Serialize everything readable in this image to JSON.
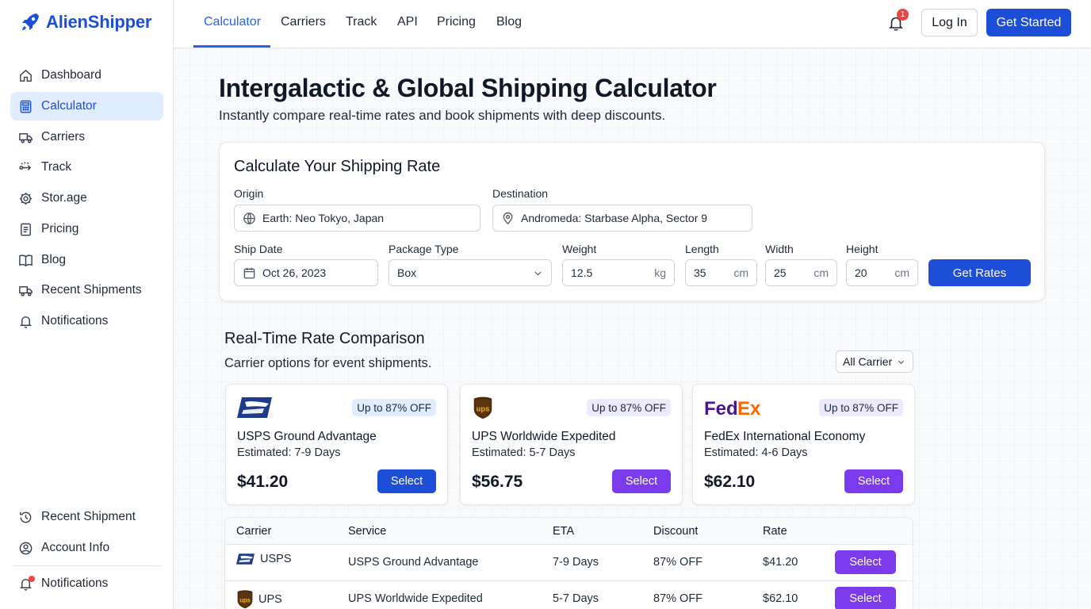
{
  "brand": {
    "name": "AlienShipper"
  },
  "sidebar": {
    "items": [
      {
        "label": "Dashboard",
        "icon": "home-icon"
      },
      {
        "label": "Calculator",
        "icon": "calculator-icon"
      },
      {
        "label": "Carriers",
        "icon": "truck-icon"
      },
      {
        "label": "Track",
        "icon": "route-icon"
      },
      {
        "label": "Stor.age",
        "icon": "gear-icon"
      },
      {
        "label": "Pricing",
        "icon": "document-icon"
      },
      {
        "label": "Blog",
        "icon": "book-icon"
      },
      {
        "label": "Recent Shipments",
        "icon": "truck-icon"
      },
      {
        "label": "Notifications",
        "icon": "bell-icon"
      }
    ],
    "bottom_items": [
      {
        "label": "Recent Shipment",
        "icon": "history-icon"
      },
      {
        "label": "Account Info",
        "icon": "user-circle-icon"
      },
      {
        "label": "Notifications",
        "icon": "bell-icon"
      }
    ],
    "active": "Calculator"
  },
  "topnav": {
    "links": [
      "Calculator",
      "Carriers",
      "Track",
      "API",
      "Pricing",
      "Blog"
    ],
    "active": "Calculator",
    "notification_count": "1",
    "login_label": "Log In",
    "cta_label": "Get Started"
  },
  "page": {
    "title": "Intergalactic & Global Shipping Calculator",
    "subtitle": "Instantly compare real-time rates and book shipments with deep discounts."
  },
  "calculator": {
    "title": "Calculate Your Shipping Rate",
    "origin_label": "Origin",
    "origin_value": "Earth: Neo Tokyo, Japan",
    "destination_label": "Destination",
    "destination_value": "Andromeda: Starbase Alpha, Sector 9",
    "ship_date_label": "Ship Date",
    "ship_date_value": "Oct 26, 2023",
    "package_type_label": "Package Type",
    "package_type_value": "Box",
    "weight_label": "Weight",
    "weight_value": "12.5",
    "weight_unit": "kg",
    "length_label": "Length",
    "length_value": "35",
    "width_label": "Width",
    "width_value": "25",
    "height_label": "Height",
    "height_value": "20",
    "dim_unit": "cm",
    "submit_label": "Get Rates"
  },
  "comparison": {
    "title": "Real-Time Rate Comparison",
    "subtitle": "Carrier options for event shipments.",
    "filter_value": "All Carrier",
    "cards": [
      {
        "carrier": "USPS",
        "badge": "Up to 87% OFF",
        "service": "USPS Ground Advantage",
        "estimate": "Estimated: 7-9 Days",
        "price": "$41.20",
        "button": "Select",
        "button_color": "#1d4ed8",
        "badge_color": "#e0ecff"
      },
      {
        "carrier": "UPS",
        "badge": "Up to 87% OFF",
        "service": "UPS Worldwide Expedited",
        "estimate": "Estimated: 5-7 Days",
        "price": "$56.75",
        "button": "Select",
        "button_color": "#7c3aed",
        "badge_color": "#ede9fe"
      },
      {
        "carrier": "FedEx",
        "badge": "Up to 87% OFF",
        "service": "FedEx International Economy",
        "estimate": "Estimated: 4-6 Days",
        "price": "$62.10",
        "button": "Select",
        "button_color": "#7c3aed",
        "badge_color": "#ede9fe"
      }
    ],
    "table": {
      "headers": [
        "Carrier",
        "Service",
        "ETA",
        "Discount",
        "Rate"
      ],
      "rows": [
        {
          "carrier": "USPS",
          "service": "USPS Ground Advantage",
          "eta": "7-9 Days",
          "discount": "87% OFF",
          "rate": "$41.20",
          "button": "Select"
        },
        {
          "carrier": "UPS",
          "service": "UPS Worldwide Expedited",
          "eta": "5-7 Days",
          "discount": "87% OFF",
          "rate": "$62.10",
          "button": "Select"
        }
      ]
    }
  },
  "colors": {
    "primary": "#1d4ed8",
    "accent": "#7c3aed",
    "alert": "#ef4444"
  }
}
